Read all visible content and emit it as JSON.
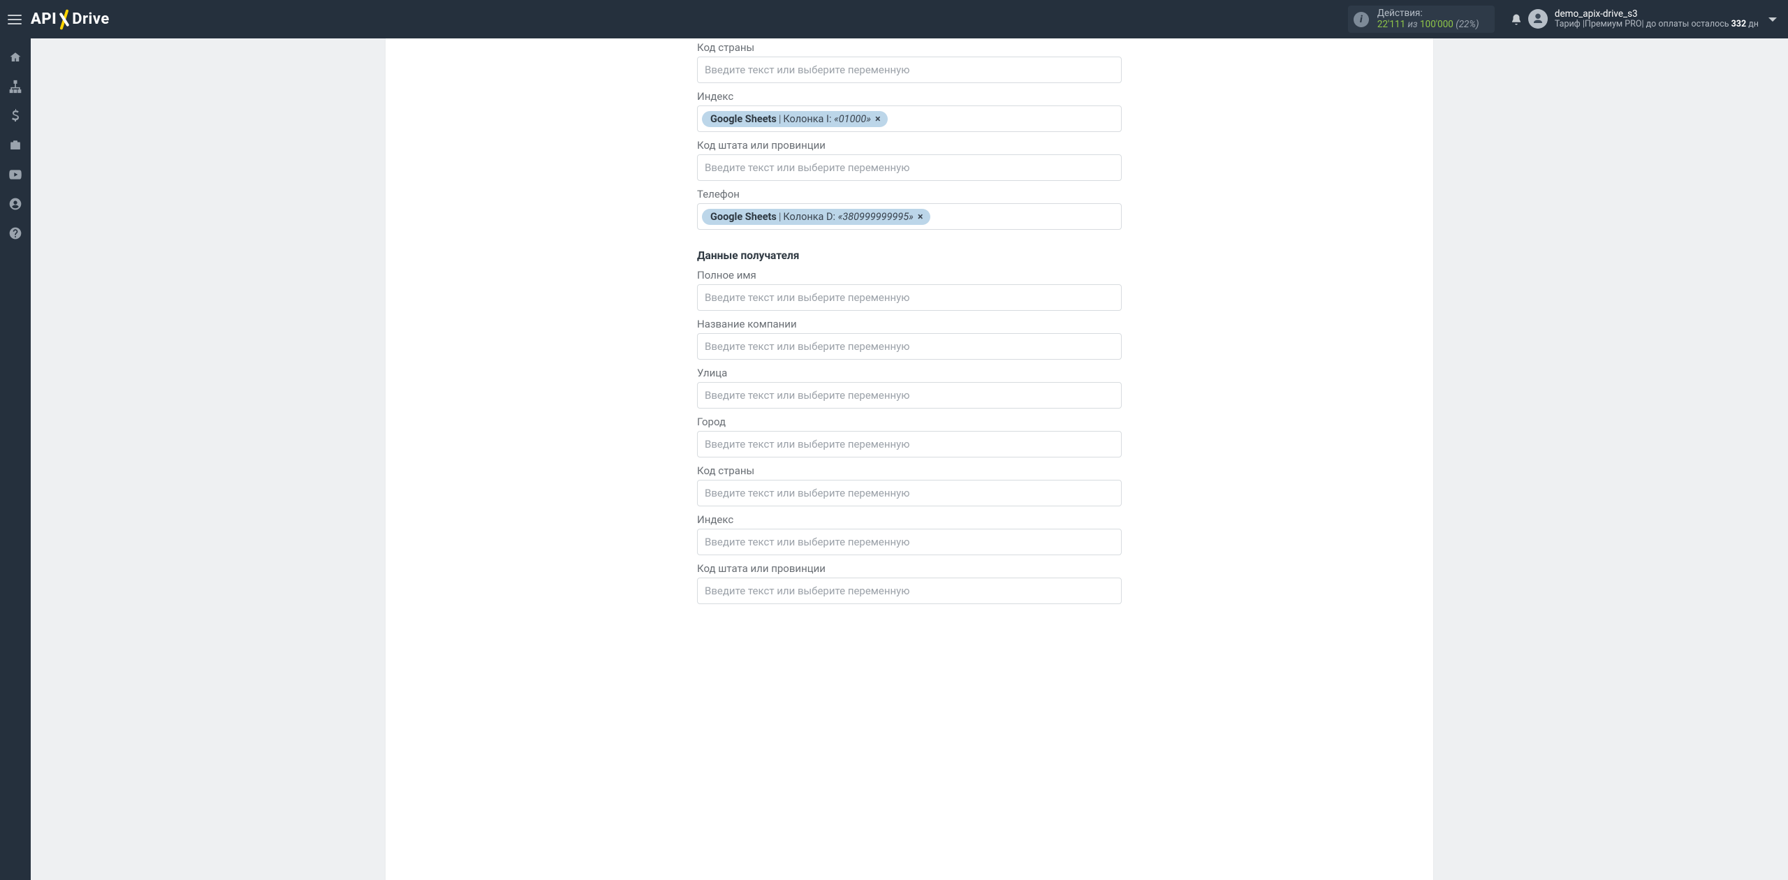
{
  "header": {
    "actions_label": "Действия:",
    "actions_used": "22'111",
    "actions_of": " из ",
    "actions_limit": "100'000",
    "actions_pct": " (22%)",
    "user_name": "demo_apix-drive_s3",
    "tariff_prefix": "Тариф |",
    "tariff_name": "Премиум PRO",
    "tariff_mid": "| до оплаты осталось ",
    "tariff_days": "332",
    "tariff_suffix": " дн"
  },
  "placeholder_text": "Введите текст или выберите переменную",
  "chip_source": "Google Sheets",
  "sender": {
    "country_code_label": "Код страны",
    "index_label": "Индекс",
    "index_chip_col": "Колонка I:",
    "index_chip_val": "«01000»",
    "state_label": "Код штата или провинции",
    "phone_label": "Телефон",
    "phone_chip_col": "Колонка D:",
    "phone_chip_val": "«380999999995»"
  },
  "recipient": {
    "section_title": "Данные получателя",
    "full_name_label": "Полное имя",
    "company_label": "Название компании",
    "street_label": "Улица",
    "city_label": "Город",
    "country_code_label": "Код страны",
    "index_label": "Индекс",
    "state_label": "Код штата или провинции"
  }
}
